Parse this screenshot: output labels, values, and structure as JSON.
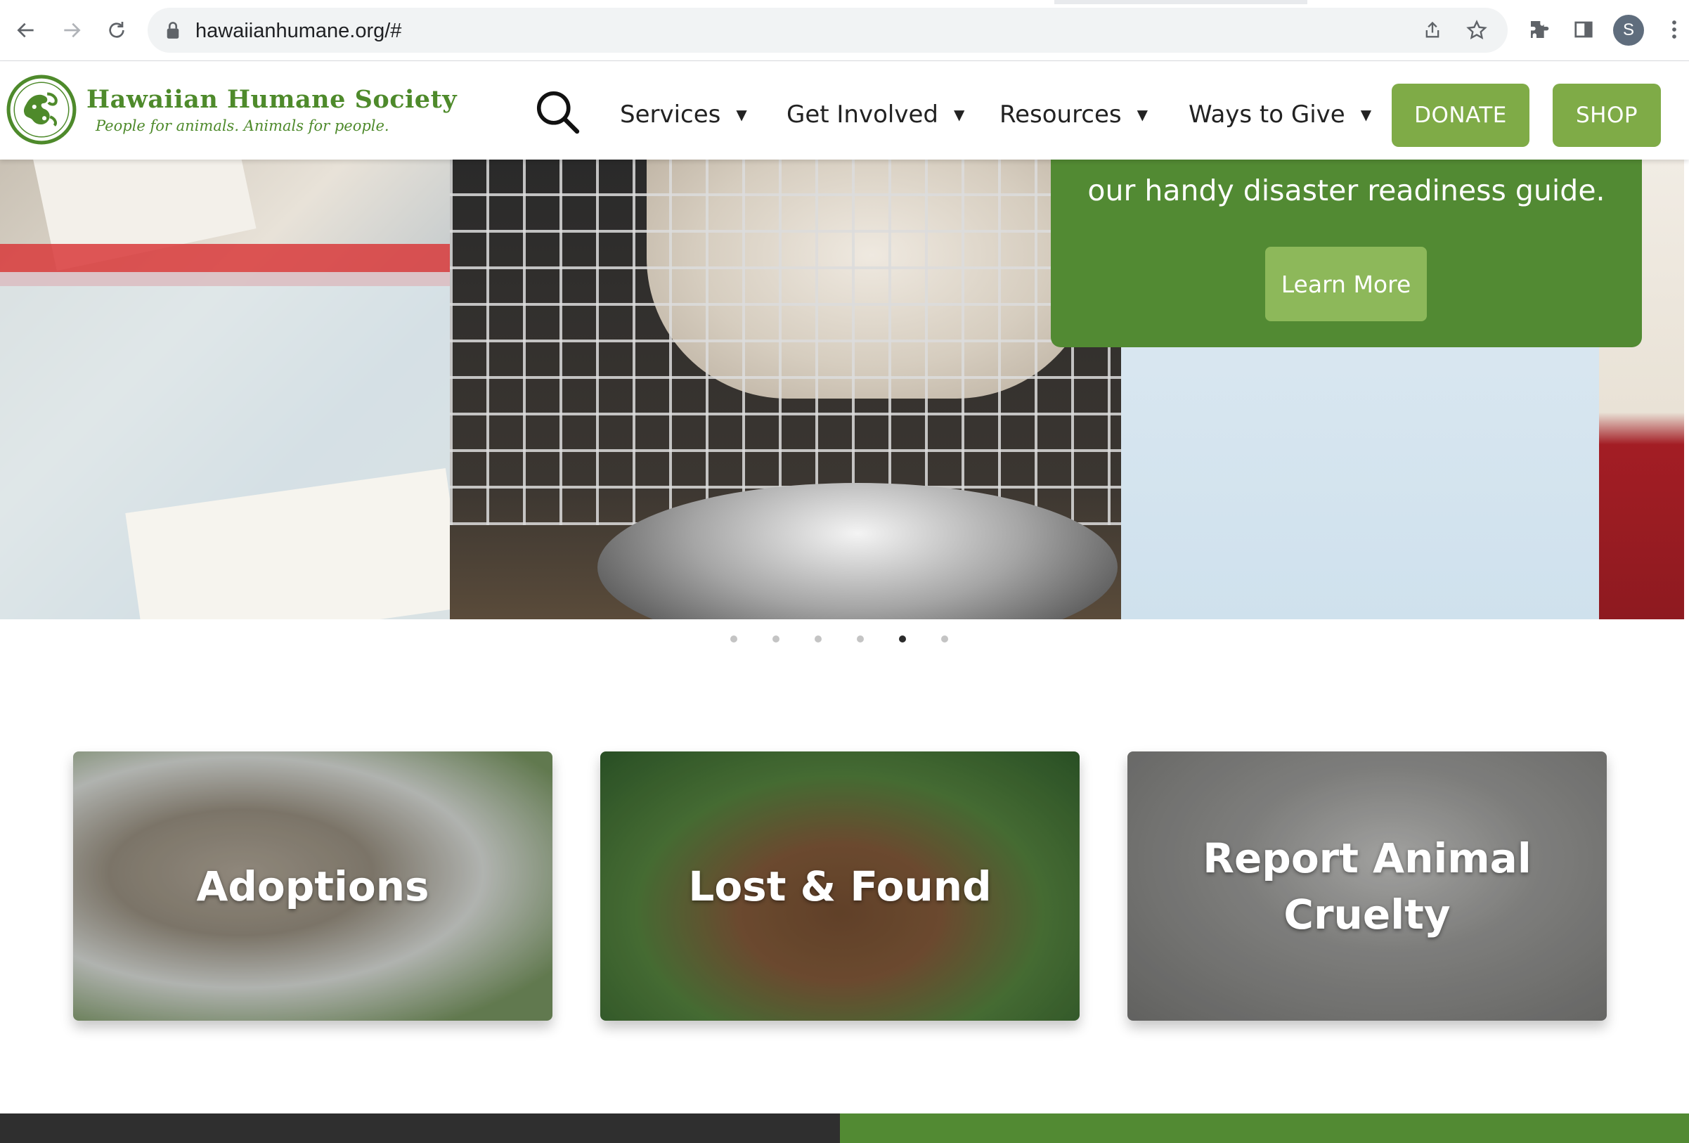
{
  "browser": {
    "url": "hawaiianhumane.org/#",
    "profile_initial": "S"
  },
  "site": {
    "name": "Hawaiian Humane Society",
    "tagline": "People for animals. Animals for people.",
    "nav": [
      {
        "label": "Services"
      },
      {
        "label": "Get Involved"
      },
      {
        "label": "Resources"
      },
      {
        "label": "Ways to Give"
      }
    ],
    "donate_label": "DONATE",
    "shop_label": "SHOP"
  },
  "hero": {
    "overlay_text": "our handy disaster readiness guide.",
    "learn_more_label": "Learn More",
    "slide_count": 6,
    "active_slide": 5
  },
  "cards": [
    {
      "label": "Adoptions"
    },
    {
      "label": "Lost & Found"
    },
    {
      "label": "Report Animal Cruelty"
    }
  ],
  "colors": {
    "brand_green": "#528a33",
    "button_green": "#7fab47",
    "logo_green": "#4e8a2b"
  },
  "icons": {
    "back": "arrow-left-icon",
    "forward": "arrow-right-icon",
    "reload": "reload-icon",
    "lock": "lock-icon",
    "share": "share-icon",
    "bookmark": "star-icon",
    "extensions": "puzzle-icon",
    "sidepanel": "sidepanel-icon",
    "menu": "kebab-menu-icon",
    "search": "search-icon"
  }
}
